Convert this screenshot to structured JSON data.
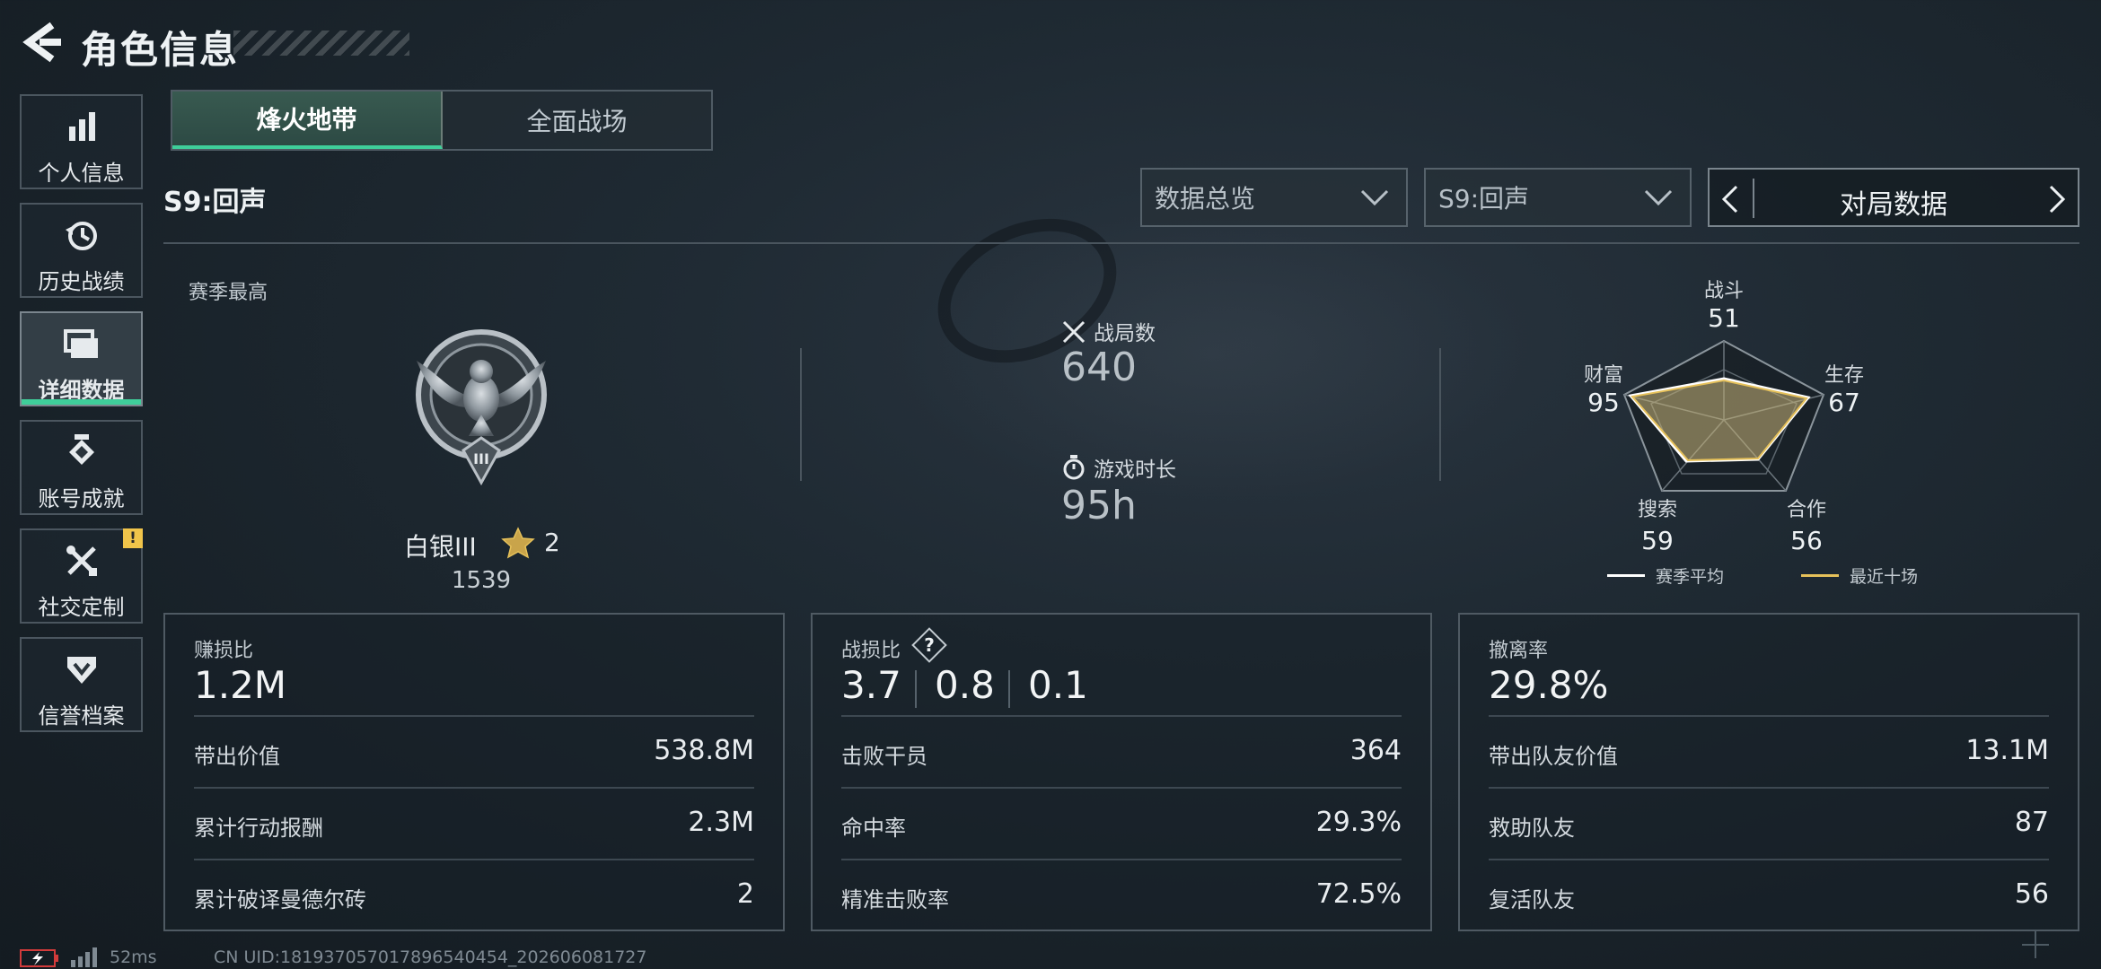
{
  "header": {
    "title": "角色信息"
  },
  "sidebar": {
    "items": [
      {
        "label": "个人信息"
      },
      {
        "label": "历史战绩"
      },
      {
        "label": "详细数据"
      },
      {
        "label": "账号成就"
      },
      {
        "label": "社交定制",
        "badge": "!"
      },
      {
        "label": "信誉档案"
      }
    ]
  },
  "tabs": [
    {
      "label": "烽火地带"
    },
    {
      "label": "全面战场"
    }
  ],
  "season_label": "S9:回声",
  "filters": {
    "overview": "数据总览",
    "season": "S9:回声",
    "pager": "对局数据"
  },
  "rank": {
    "heading": "赛季最高",
    "name": "白银III",
    "stars": "2",
    "score": "1539",
    "emblem_numeral": "III"
  },
  "summary": {
    "matches_label": "战局数",
    "matches_value": "640",
    "playtime_label": "游戏时长",
    "playtime_value": "95h"
  },
  "radar": {
    "axes": [
      {
        "label": "战斗",
        "value": "51"
      },
      {
        "label": "生存",
        "value": "67"
      },
      {
        "label": "合作",
        "value": "56"
      },
      {
        "label": "搜索",
        "value": "59"
      },
      {
        "label": "财富",
        "value": "95"
      }
    ],
    "legend": [
      {
        "label": "赛季平均",
        "color": "#ffffff"
      },
      {
        "label": "最近十场",
        "color": "#e6c15a"
      }
    ]
  },
  "cards": {
    "profit": {
      "title": "赚损比",
      "value": "1.2M",
      "rows": [
        {
          "k": "带出价值",
          "v": "538.8M"
        },
        {
          "k": "累计行动报酬",
          "v": "2.3M"
        },
        {
          "k": "累计破译曼德尔砖",
          "v": "2"
        }
      ]
    },
    "combat": {
      "title": "战损比",
      "help": "?",
      "values": [
        "3.7",
        "0.8",
        "0.1"
      ],
      "rows": [
        {
          "k": "击败干员",
          "v": "364"
        },
        {
          "k": "命中率",
          "v": "29.3%"
        },
        {
          "k": "精准击败率",
          "v": "72.5%"
        }
      ]
    },
    "extract": {
      "title": "撤离率",
      "value": "29.8%",
      "rows": [
        {
          "k": "带出队友价值",
          "v": "13.1M"
        },
        {
          "k": "救助队友",
          "v": "87"
        },
        {
          "k": "复活队友",
          "v": "56"
        }
      ]
    }
  },
  "footer": {
    "ping": "52ms",
    "uid": "CN UID:181937057017896540454_202606081727"
  },
  "colors": {
    "accent": "#3fce9a",
    "warn": "#f0c44a",
    "gold": "#e6c15a"
  }
}
